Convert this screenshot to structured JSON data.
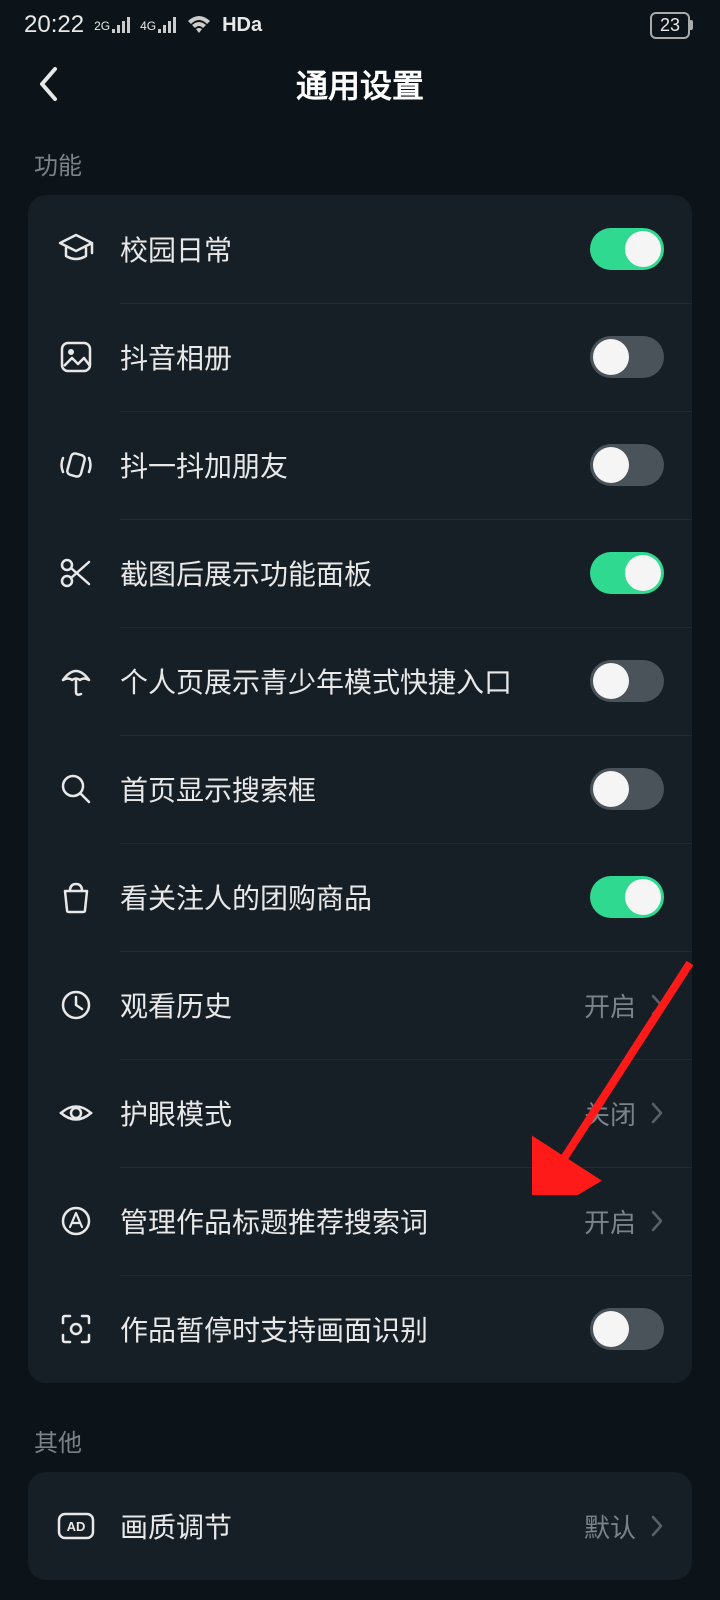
{
  "status": {
    "time": "20:22",
    "signal_2g": "2G",
    "signal_4g": "4G",
    "hd": "HDa",
    "battery": "23"
  },
  "header": {
    "title": "通用设置"
  },
  "sections": {
    "functions_label": "功能",
    "other_label": "其他"
  },
  "rows": {
    "campus": {
      "label": "校园日常",
      "toggle": true
    },
    "album": {
      "label": "抖音相册",
      "toggle": false
    },
    "shake": {
      "label": "抖一抖加朋友",
      "toggle": false
    },
    "screenshot": {
      "label": "截图后展示功能面板",
      "toggle": true
    },
    "teen": {
      "label": "个人页展示青少年模式快捷入口",
      "toggle": false
    },
    "search": {
      "label": "首页显示搜索框",
      "toggle": false
    },
    "shop": {
      "label": "看关注人的团购商品",
      "toggle": true
    },
    "history": {
      "label": "观看历史",
      "value": "开启"
    },
    "eyecare": {
      "label": "护眼模式",
      "value": "关闭"
    },
    "keywords": {
      "label": "管理作品标题推荐搜索词",
      "value": "开启"
    },
    "recognition": {
      "label": "作品暂停时支持画面识别",
      "toggle": false
    },
    "quality": {
      "label": "画质调节",
      "value": "默认"
    }
  }
}
